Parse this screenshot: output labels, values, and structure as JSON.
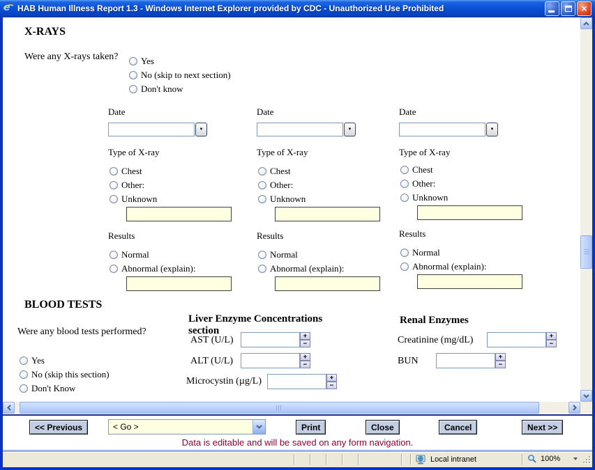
{
  "window": {
    "title": "HAB Human Illness Report 1.3 - Windows Internet Explorer provided by CDC - Unauthorized Use Prohibited"
  },
  "icons": {
    "close": "×",
    "combo_dropdown": "▼",
    "spin_up": "+",
    "spin_down": "−"
  },
  "xray": {
    "heading": "X-RAYS",
    "question": "Were any X-rays taken?",
    "options": [
      "Yes",
      "No (skip to next section)",
      "Don't know"
    ],
    "columns": [
      {
        "date_label": "Date",
        "type_label": "Type of X-ray",
        "types": [
          "Chest",
          "Other:",
          "Unknown"
        ],
        "results_label": "Results",
        "results": [
          "Normal",
          "Abnormal (explain):"
        ]
      },
      {
        "date_label": "Date",
        "type_label": "Type of X-ray",
        "types": [
          "Chest",
          "Other:",
          "Unknown"
        ],
        "results_label": "Results",
        "results": [
          "Normal",
          "Abnormal (explain):"
        ]
      },
      {
        "date_label": "Date",
        "type_label": "Type of X-ray",
        "types": [
          "Chest",
          "Other:",
          "Unknown"
        ],
        "results_label": "Results",
        "results": [
          "Normal",
          "Abnormal (explain):"
        ]
      }
    ]
  },
  "blood": {
    "heading": "BLOOD TESTS",
    "question": "Were any blood tests performed?",
    "options": [
      "Yes",
      "No (skip this section)",
      "Don't Know"
    ],
    "liver": {
      "heading": "Liver Enzyme Concentrations section",
      "rows": [
        "AST (U/L)",
        "ALT (U/L)",
        "Microcystin (µg/L)"
      ]
    },
    "renal": {
      "heading": "Renal Enzymes",
      "rows": [
        "Creatinine (mg/dL)",
        "BUN"
      ]
    }
  },
  "nav": {
    "previous": "<< Previous",
    "go": "< Go >",
    "print": "Print",
    "close": "Close",
    "cancel": "Cancel",
    "next": "Next >>",
    "notice": "Data is editable and will be saved on any form navigation."
  },
  "statusbar": {
    "zone": "Local intranet",
    "zoom": "100%"
  },
  "colors": {
    "frame_blue": "#0833c8",
    "input_yellow": "#ffffe1",
    "notice_red": "#990033",
    "button_face": "#c4cee2",
    "statusbar_bg": "#ece9d8"
  }
}
